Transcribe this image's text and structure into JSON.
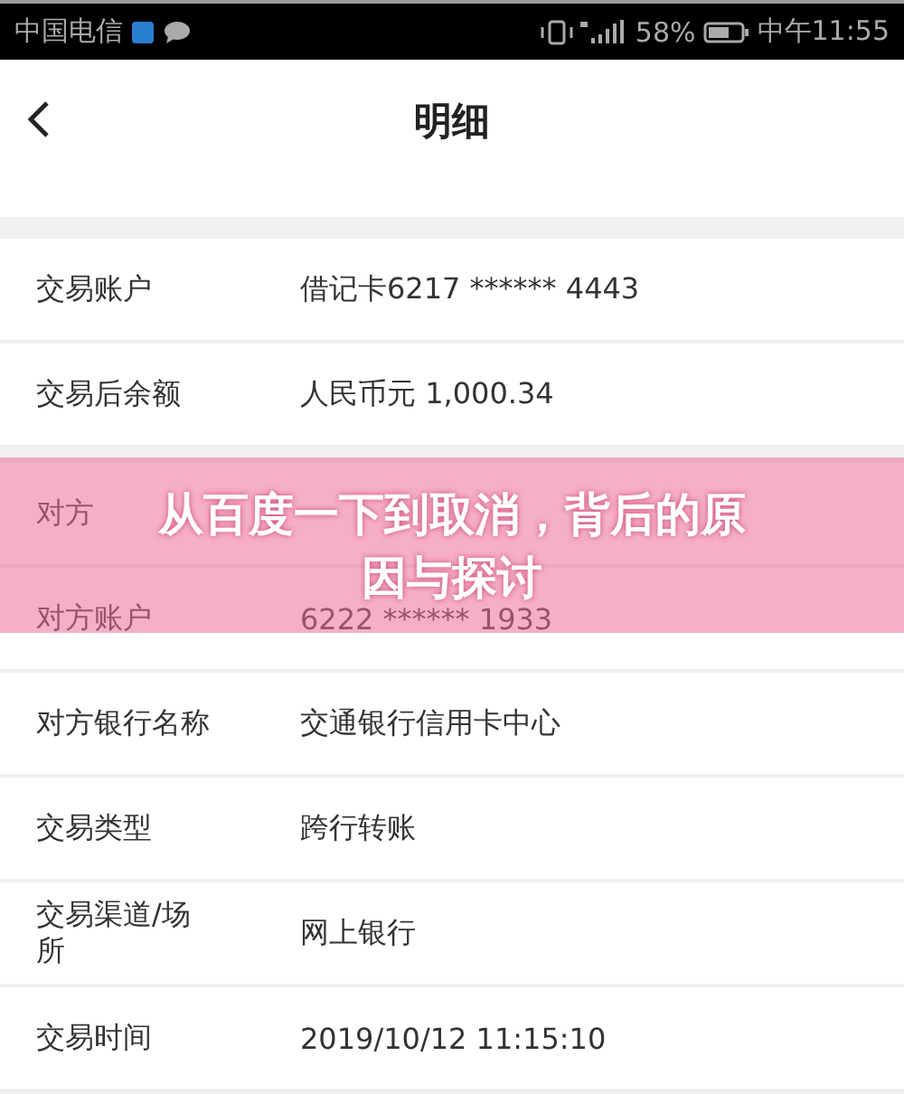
{
  "status_bar": {
    "carrier": "中国电信",
    "battery": "58%",
    "time": "中午11:55"
  },
  "header": {
    "title": "明细"
  },
  "sections": [
    {
      "rows": [
        {
          "label": "交易账户",
          "value": "借记卡6217 ****** 4443"
        },
        {
          "label": "交易后余额",
          "value": "人民币元 1,000.34"
        }
      ]
    },
    {
      "rows": [
        {
          "label": "对方"
        },
        {
          "label": "对方账户",
          "value": "6222 ****** 1933"
        },
        {
          "label": "对方银行名称",
          "value": "交通银行信用卡中心"
        },
        {
          "label": "交易类型",
          "value": "跨行转账"
        },
        {
          "label": "交易渠道/场所",
          "value": "网上银行"
        },
        {
          "label": "交易时间",
          "value": "2019/10/12 11:15:10"
        }
      ]
    }
  ],
  "banner": {
    "title": "从百度一下到取消，背后的原因与探讨"
  }
}
